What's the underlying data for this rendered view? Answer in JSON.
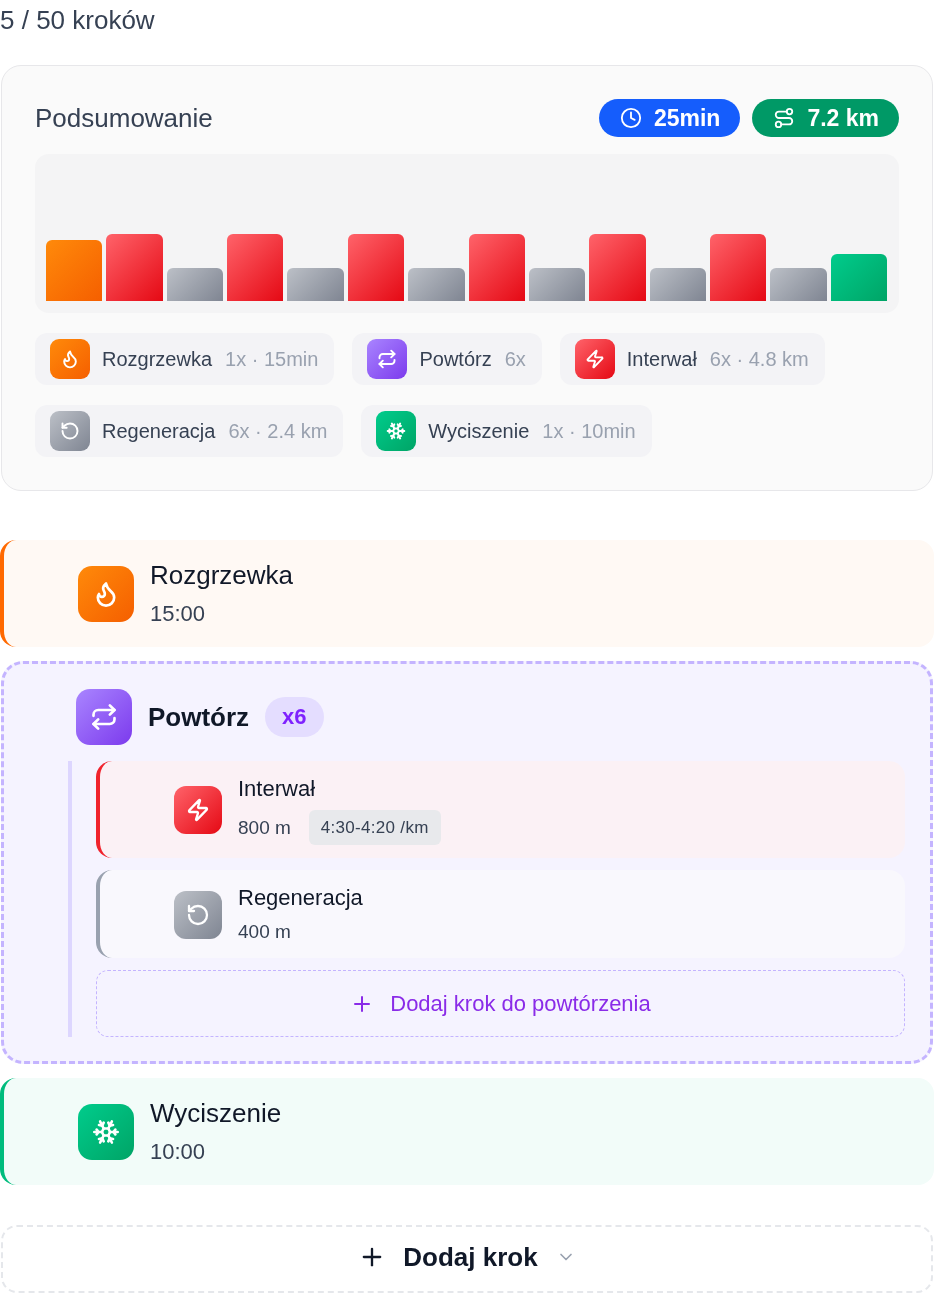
{
  "step_count": "5 / 50 kroków",
  "summary": {
    "title": "Podsumowanie",
    "total_time": "25min",
    "total_distance": "7.2 km",
    "timeline": [
      {
        "kind": "warmup"
      },
      {
        "kind": "interval"
      },
      {
        "kind": "recovery"
      },
      {
        "kind": "interval"
      },
      {
        "kind": "recovery"
      },
      {
        "kind": "interval"
      },
      {
        "kind": "recovery"
      },
      {
        "kind": "interval"
      },
      {
        "kind": "recovery"
      },
      {
        "kind": "interval"
      },
      {
        "kind": "recovery"
      },
      {
        "kind": "interval"
      },
      {
        "kind": "recovery"
      },
      {
        "kind": "cooldown"
      }
    ],
    "legend": [
      {
        "kind": "warmup",
        "label": "Rozgrzewka",
        "meta": "1x · 15min"
      },
      {
        "kind": "repeat",
        "label": "Powtórz",
        "meta": "6x"
      },
      {
        "kind": "interval",
        "label": "Interwał",
        "meta": "6x · 4.8 km"
      },
      {
        "kind": "recovery",
        "label": "Regeneracja",
        "meta": "6x · 2.4 km"
      },
      {
        "kind": "cooldown",
        "label": "Wyciszenie",
        "meta": "1x · 10min"
      }
    ]
  },
  "steps": [
    {
      "kind": "warmup",
      "title": "Rozgrzewka",
      "duration": "15:00"
    },
    {
      "kind": "repeat",
      "title": "Powtórz",
      "count": "x6",
      "children": [
        {
          "kind": "interval",
          "title": "Interwał",
          "distance": "800 m",
          "pace": "4:30-4:20 /km"
        },
        {
          "kind": "recovery",
          "title": "Regeneracja",
          "distance": "400 m"
        }
      ],
      "add_label": "Dodaj krok do powtórzenia"
    },
    {
      "kind": "cooldown",
      "title": "Wyciszenie",
      "duration": "10:00"
    }
  ],
  "add_step": {
    "label": "Dodaj krok"
  }
}
